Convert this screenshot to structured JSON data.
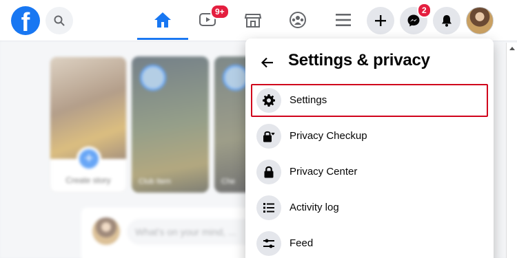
{
  "header": {
    "logo_letter": "f",
    "watch_badge": "9+",
    "messenger_badge": "2"
  },
  "background": {
    "create_story_label": "Create story",
    "story_2_name": "Club Item",
    "story_3_name": "Che",
    "composer_placeholder": "What's on your mind, ..."
  },
  "settings_panel": {
    "title": "Settings & privacy",
    "items": [
      {
        "label": "Settings",
        "icon": "gear-icon"
      },
      {
        "label": "Privacy Checkup",
        "icon": "lock-heart-icon"
      },
      {
        "label": "Privacy Center",
        "icon": "lock-icon"
      },
      {
        "label": "Activity log",
        "icon": "list-icon"
      },
      {
        "label": "Feed",
        "icon": "sliders-icon"
      }
    ]
  },
  "colors": {
    "brand": "#1877f2",
    "badge": "#e41e3f",
    "highlight_border": "#d0021b"
  }
}
